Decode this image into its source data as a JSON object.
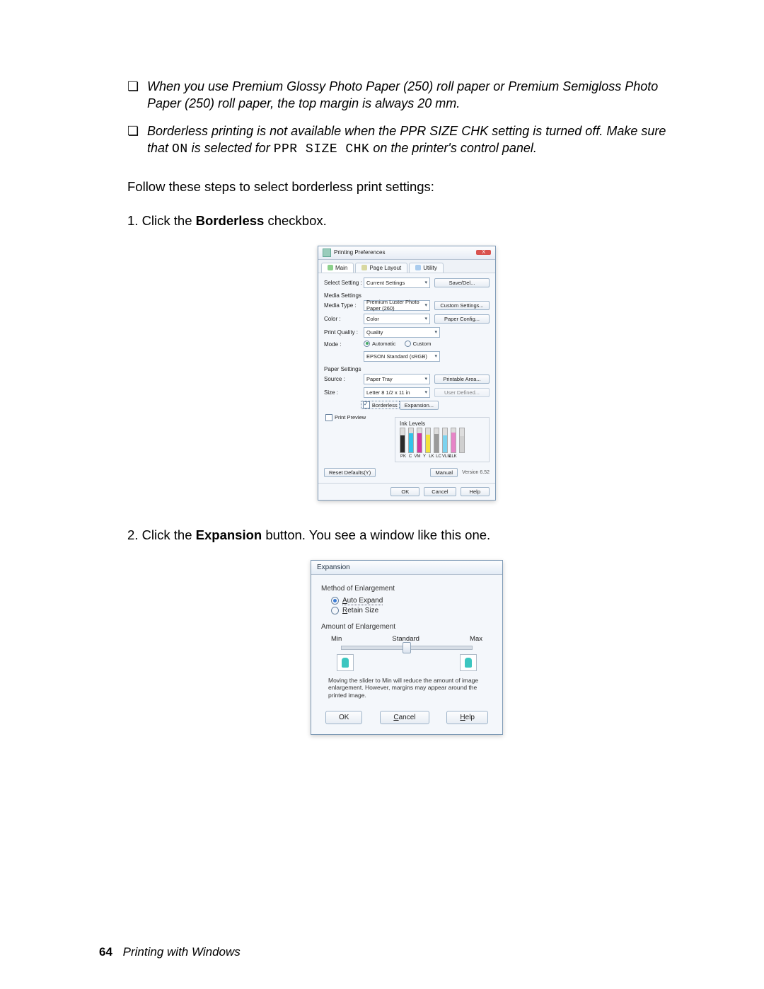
{
  "bullets": {
    "b1": "When you use Premium Glossy Photo Paper (250) roll paper or Premium Semigloss Photo Paper (250) roll paper, the top margin is always 20 mm.",
    "b2_prefix": "Borderless printing is not available when the PPR SIZE CHK setting is turned off. Make sure that ",
    "b2_on": "ON",
    "b2_mid": " is selected for ",
    "b2_code": "PPR SIZE CHK",
    "b2_suffix": " on the printer's control panel."
  },
  "para_intro": "Follow these steps to select borderless print settings:",
  "step1_prefix": "1. Click the ",
  "step1_bold": "Borderless",
  "step1_suffix": " checkbox.",
  "step2_prefix": "2. Click the ",
  "step2_bold": "Expansion",
  "step2_suffix": " button. You see a window like this one.",
  "footer": {
    "page": "64",
    "section": "Printing with Windows"
  },
  "pref": {
    "title": "Printing Preferences",
    "close": "X",
    "tabs": {
      "main": "Main",
      "pagelayout": "Page Layout",
      "utility": "Utility"
    },
    "select_setting_label": "Select Setting :",
    "select_setting_value": "Current Settings",
    "save_del": "Save/Del...",
    "media_settings_label": "Media Settings",
    "media_type_label": "Media Type :",
    "media_type_value": "Premium Luster Photo Paper (260)",
    "custom_settings": "Custom Settings...",
    "color_label": "Color :",
    "color_value": "Color",
    "paper_config": "Paper Config...",
    "print_quality_label": "Print Quality :",
    "print_quality_value": "Quality",
    "mode_label": "Mode :",
    "mode_auto": "Automatic",
    "mode_custom": "Custom",
    "mode_profile": "EPSON Standard (sRGB)",
    "paper_settings_label": "Paper Settings",
    "source_label": "Source :",
    "source_value": "Paper Tray",
    "printable_area": "Printable Area...",
    "size_label": "Size :",
    "size_value": "Letter 8 1/2 x 11 in",
    "user_defined": "User Defined...",
    "borderless": "Borderless",
    "expansion": "Expansion...",
    "print_preview": "Print Preview",
    "ink_levels": "Ink Levels",
    "inks": [
      "PK",
      "C",
      "VM",
      "Y",
      "LK",
      "LC",
      "VLM",
      "LLK"
    ],
    "ink_colors": [
      "#2a2a2a",
      "#34c3ea",
      "#d23aa0",
      "#f4e23c",
      "#9a9a9a",
      "#7cd3ef",
      "#e785c8",
      "#cfcfcf"
    ],
    "ink_heights": [
      70,
      80,
      78,
      74,
      76,
      72,
      82,
      68
    ],
    "reset_defaults": "Reset Defaults(Y)",
    "manual": "Manual",
    "version": "Version 6.52",
    "ok": "OK",
    "cancel": "Cancel",
    "help": "Help"
  },
  "exp": {
    "title": "Expansion",
    "method_label": "Method of Enlargement",
    "auto_expand": "Auto Expand",
    "retain_size": "Retain Size",
    "amount_label": "Amount of Enlargement",
    "min": "Min",
    "standard": "Standard",
    "max": "Max",
    "hint": "Moving the slider to Min will reduce the amount of image enlargement. However, margins may appear around the printed image.",
    "ok": "OK",
    "cancel": "Cancel",
    "help": "Help"
  }
}
